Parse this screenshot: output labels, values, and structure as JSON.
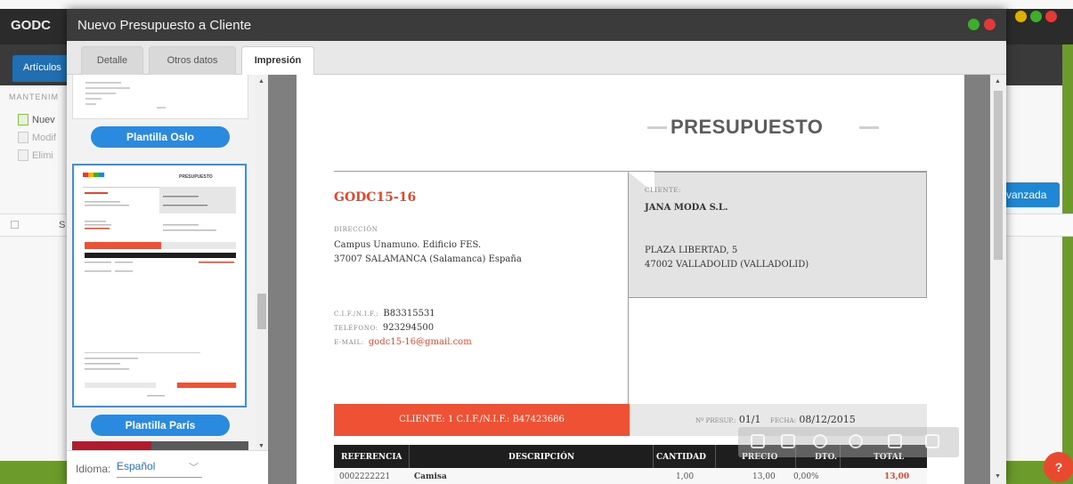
{
  "background_app": {
    "title": "GODC",
    "tab_articulos": "Artículos",
    "section": "MANTENIM",
    "actions": [
      "Nuev",
      "Modif",
      "Elimi"
    ],
    "column_letter": "S",
    "advanced_button": "vanzada",
    "help_icon": "?"
  },
  "dialog": {
    "title": "Nuevo Presupuesto a Cliente",
    "tabs": [
      "Detalle",
      "Otros datos",
      "Impresión"
    ],
    "active_tab": "Impresión",
    "templates": [
      "Plantilla Oslo",
      "Plantilla París"
    ],
    "template_thumb_title": "PRESUPUESTO",
    "language_label": "Idioma:",
    "language_value": "Español"
  },
  "document": {
    "title": "PRESUPUESTO",
    "code": "GODC15-16",
    "address_label": "DIRECCIÓN",
    "address_line1": "Campus Unamuno. Edificio FES.",
    "address_line2": "37007 SALAMANCA (Salamanca) España",
    "cif_label": "C.I.F./N.I.F.:",
    "cif": "B83315531",
    "phone_label": "TELÉFONO:",
    "phone": "923294500",
    "email_label": "E-MAIL:",
    "email": "godc15-16@gmail.com",
    "client_label": "CLIENTE:",
    "client_name": "JANA MODA S.L.",
    "client_address1": "PLAZA LIBERTAD, 5",
    "client_address2": "47002 VALLADOLID (VALLADOLID)",
    "red_bar": "CLIENTE: 1   C.I.F./N.I.F.: B47423686",
    "presup_label": "Nº PRESUP.:",
    "presup_value": "01/1",
    "fecha_label": "FECHA:",
    "fecha_value": "08/12/2015",
    "table": {
      "headers": [
        "REFERENCIA",
        "DESCRIPCIÓN",
        "CANTIDAD",
        "PRECIO",
        "DTO.",
        "TOTAL"
      ],
      "rows": [
        [
          "0002222221",
          "Camisa",
          "1,00",
          "13,00",
          "0,00%",
          "13,00"
        ]
      ]
    }
  },
  "colors": {
    "accent_red": "#ef5134",
    "accent_blue": "#2a8ae0",
    "dark_bar": "#1e1e1e"
  }
}
